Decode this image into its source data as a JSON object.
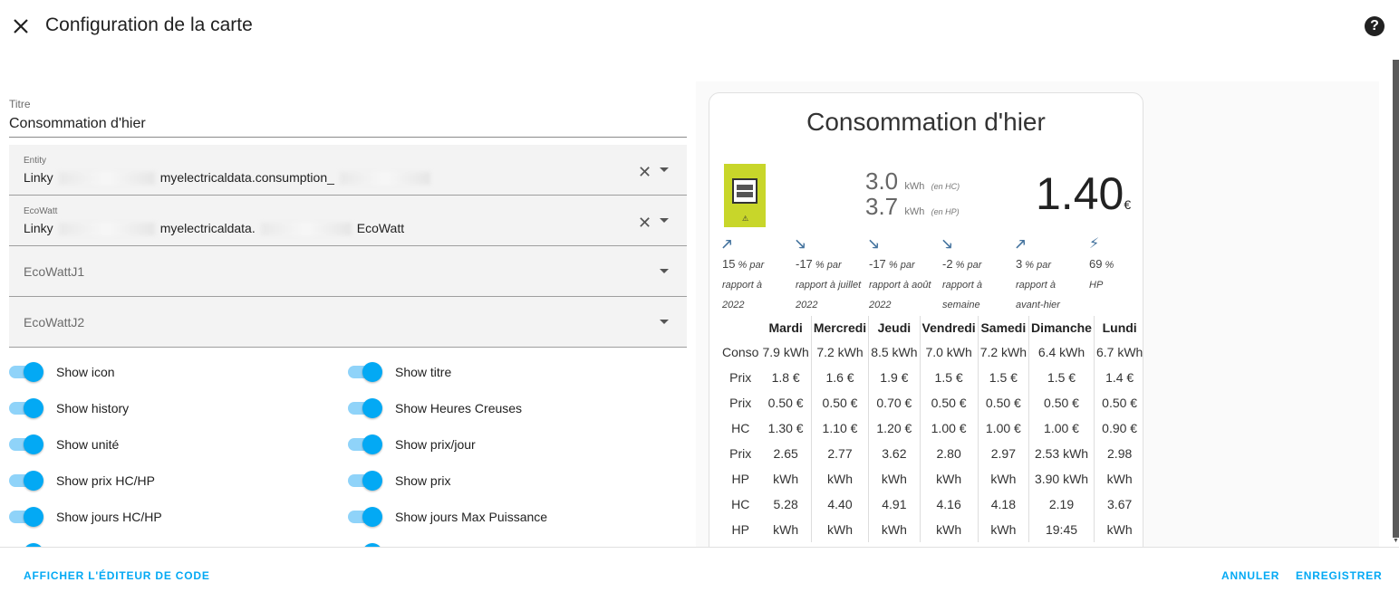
{
  "header": {
    "title": "Configuration de la carte",
    "close_icon": "close-icon",
    "help_icon": "help-circle-icon",
    "help_glyph": "?"
  },
  "form": {
    "title_field": {
      "label": "Titre",
      "value": "Consommation d'hier"
    },
    "entity": {
      "label": "Entity",
      "value_prefix": "Linky",
      "value_suffix": "myelectricaldata.consumption_"
    },
    "ecowatt": {
      "label": "EcoWatt",
      "value_prefix": "Linky",
      "value_middle": "myelectricaldata.",
      "value_suffix": "EcoWatt"
    },
    "ecowatt_j1": {
      "placeholder": "EcoWattJ1"
    },
    "ecowatt_j2": {
      "placeholder": "EcoWattJ2"
    },
    "toggles_left": [
      "Show icon",
      "Show history",
      "Show unité",
      "Show prix HC/HP",
      "Show jours HC/HP"
    ],
    "toggles_right": [
      "Show titre",
      "Show Heures Creuses",
      "Show prix/jour",
      "Show prix",
      "Show jours Max Puissance"
    ]
  },
  "card": {
    "title": "Consommation d'hier",
    "kwh_hc": {
      "value": "3.0",
      "unit": "kWh",
      "tag": "(en HC)"
    },
    "kwh_hp": {
      "value": "3.7",
      "unit": "kWh",
      "tag": "(en HP)"
    },
    "total": {
      "value": "1.40",
      "unit": "€"
    },
    "meter_warning": "⚠",
    "trends": [
      {
        "icon": "arrow-up-right-icon",
        "glyph": "🡕",
        "value": "15",
        "unit": "%",
        "text1": "par",
        "text2": "rapport à",
        "text3": "2022"
      },
      {
        "icon": "arrow-down-right-icon",
        "glyph": "🡖",
        "value": "-17",
        "unit": "%",
        "text1": "par",
        "text2": "rapport à juillet",
        "text3": "2022"
      },
      {
        "icon": "arrow-down-right-icon",
        "glyph": "🡖",
        "value": "-17",
        "unit": "%",
        "text1": "par",
        "text2": "rapport à août",
        "text3": "2022"
      },
      {
        "icon": "arrow-down-right-icon",
        "glyph": "🡖",
        "value": "-2",
        "unit": "%",
        "text1": "par",
        "text2": "rapport à",
        "text3": "semaine"
      },
      {
        "icon": "arrow-up-right-icon",
        "glyph": "🡕",
        "value": "3",
        "unit": "%",
        "text1": "par",
        "text2": "rapport à",
        "text3": "avant-hier"
      },
      {
        "icon": "flash-icon",
        "glyph": "⚡",
        "value": "69",
        "unit": "%",
        "text1": "",
        "text2": "HP",
        "text3": ""
      }
    ],
    "history": {
      "days": [
        "Mardi",
        "Mercredi",
        "Jeudi",
        "Vendredi",
        "Samedi",
        "Dimanche",
        "Lundi"
      ],
      "rows": [
        {
          "label": "Conso",
          "values": [
            "7.9 kWh",
            "7.2 kWh",
            "8.5 kWh",
            "7.0 kWh",
            "7.2 kWh",
            "6.4 kWh",
            "6.7 kWh"
          ]
        },
        {
          "label": "Prix",
          "values": [
            "1.8 €",
            "1.6 €",
            "1.9 €",
            "1.5 €",
            "1.5 €",
            "1.5 €",
            "1.4 €"
          ]
        },
        {
          "label": "Prix",
          "values": [
            "0.50 €",
            "0.50 €",
            "0.70 €",
            "0.50 €",
            "0.50 €",
            "0.50 €",
            "0.50 €"
          ]
        },
        {
          "label": "HC",
          "values": [
            "1.30 €",
            "1.10 €",
            "1.20 €",
            "1.00 €",
            "1.00 €",
            "1.00 €",
            "0.90 €"
          ]
        },
        {
          "label": "Prix",
          "values": [
            "2.65",
            "2.77",
            "3.62",
            "2.80",
            "2.97",
            "2.53 kWh",
            "2.98"
          ]
        },
        {
          "label": "HP",
          "values": [
            "kWh",
            "kWh",
            "kWh",
            "kWh",
            "kWh",
            "3.90 kWh",
            "kWh"
          ]
        },
        {
          "label": "HC",
          "values": [
            "5.28",
            "4.40",
            "4.91",
            "4.16",
            "4.18",
            "2.19",
            "3.67"
          ]
        },
        {
          "label": "HP",
          "values": [
            "kWh",
            "kWh",
            "kWh",
            "kWh",
            "kWh",
            "19:45",
            "kWh"
          ]
        }
      ]
    }
  },
  "footer": {
    "code_editor": "AFFICHER L'ÉDITEUR DE CODE",
    "cancel": "ANNULER",
    "save": "ENREGISTRER"
  },
  "colors": {
    "accent": "#03a9f4",
    "toggle_track": "#8fd3f9",
    "meter": "#c8d62a",
    "trend_icon": "#44739e"
  }
}
